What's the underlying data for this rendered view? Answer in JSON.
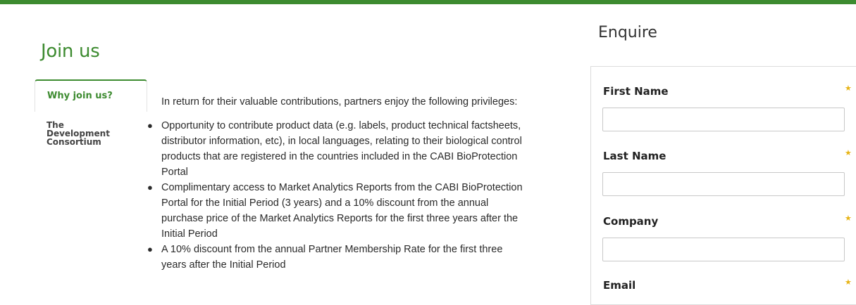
{
  "colors": {
    "brand_green": "#3d8b30",
    "required_star": "#e7b416"
  },
  "page": {
    "title": "Join us"
  },
  "sidenav": {
    "items": [
      {
        "label": "Why join us?",
        "active": true
      },
      {
        "label": "The Development Consortium",
        "active": false
      }
    ]
  },
  "content": {
    "intro": "In return for their valuable contributions, partners enjoy the following privileges:",
    "bullets": [
      "Opportunity to contribute product data (e.g. labels, product technical factsheets, distributor information, etc), in local languages, relating to their biological control products that are registered in the countries included in the CABI BioProtection Portal",
      "Complimentary access to Market Analytics Reports from the CABI BioProtection Portal for the Initial Period (3 years) and a 10% discount from the annual purchase price of the Market Analytics Reports for the first three years after the Initial Period",
      "A 10% discount from the annual Partner Membership Rate for the first three years after the Initial Period"
    ]
  },
  "enquire": {
    "title": "Enquire",
    "fields": [
      {
        "label": "First Name",
        "required_icon": "star-icon",
        "value": "",
        "placeholder": ""
      },
      {
        "label": "Last Name",
        "required_icon": "star-icon",
        "value": "",
        "placeholder": ""
      },
      {
        "label": "Company",
        "required_icon": "star-icon",
        "value": "",
        "placeholder": ""
      },
      {
        "label": "Email",
        "required_icon": "star-icon",
        "value": "",
        "placeholder": ""
      }
    ]
  }
}
